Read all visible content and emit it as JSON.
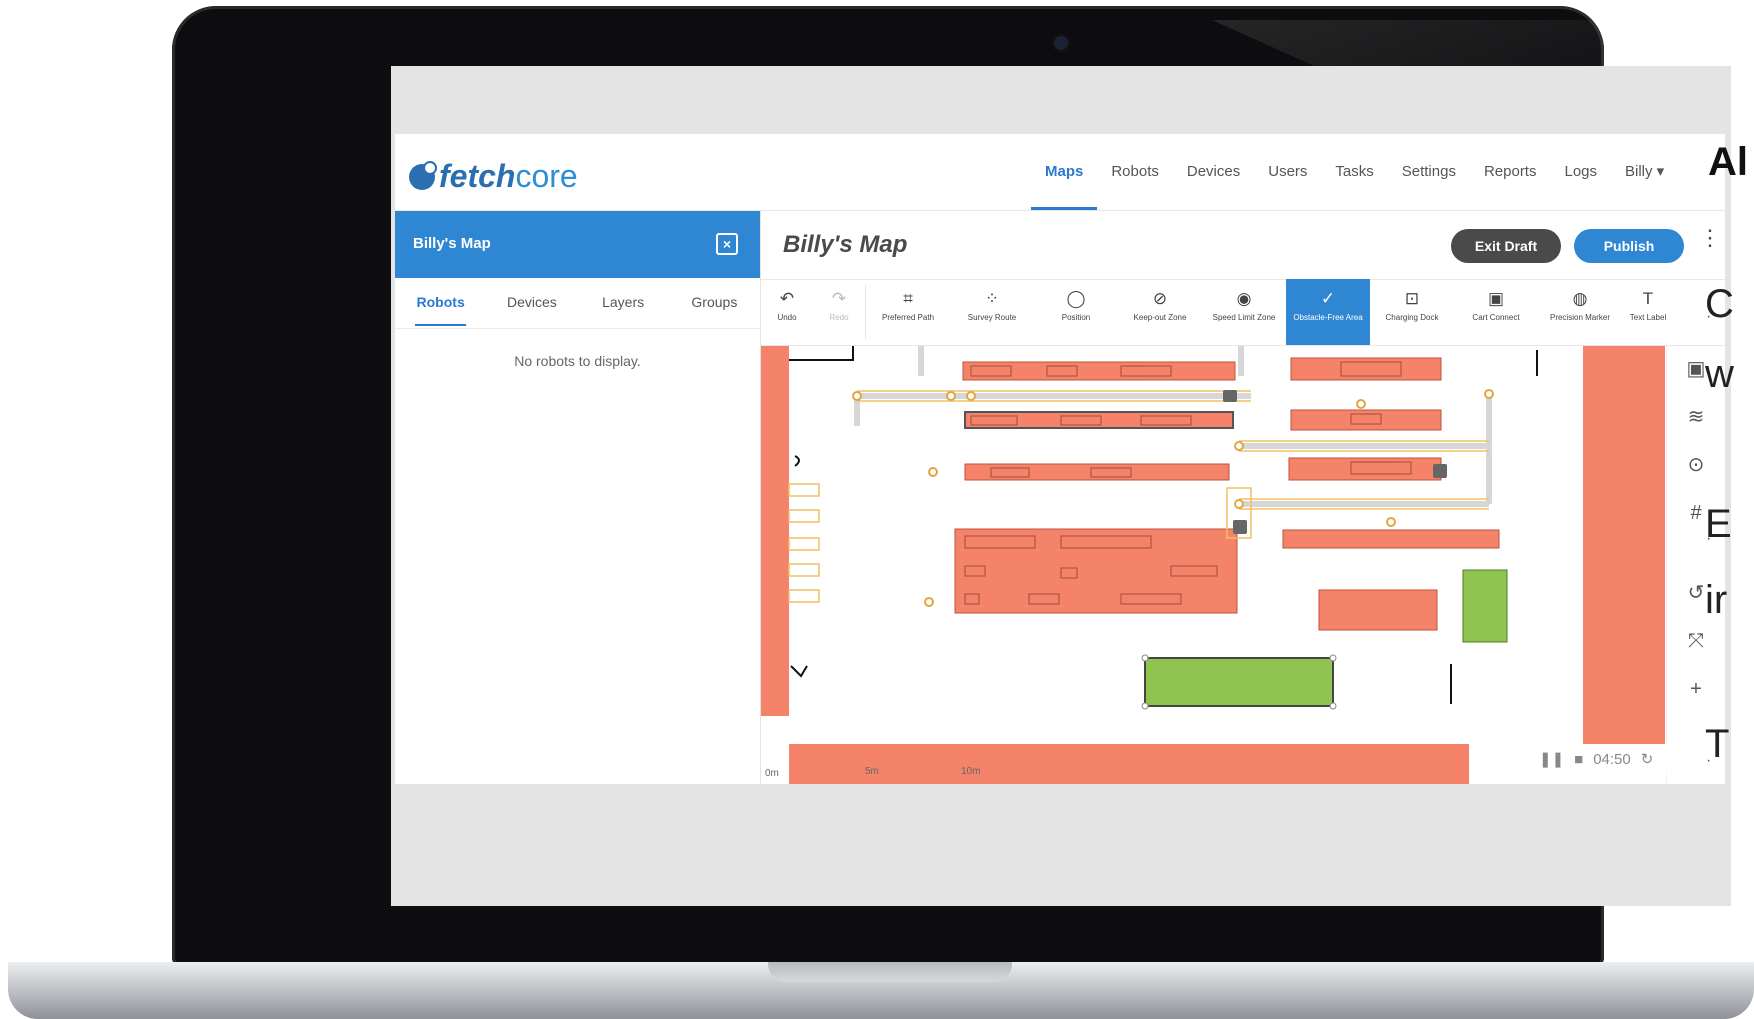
{
  "side_panel": {
    "title": "Al",
    "bullets": [
      "C",
      "w",
      "E",
      "ir",
      "T"
    ]
  },
  "app": {
    "logo": {
      "part1": "fetch",
      "part2": "core"
    },
    "nav": [
      {
        "label": "Maps",
        "active": true
      },
      {
        "label": "Robots"
      },
      {
        "label": "Devices"
      },
      {
        "label": "Users"
      },
      {
        "label": "Tasks"
      },
      {
        "label": "Settings"
      },
      {
        "label": "Reports"
      },
      {
        "label": "Logs"
      },
      {
        "label": "Billy ▾"
      }
    ],
    "sidebar": {
      "title": "Billy's Map",
      "tabs": [
        "Robots",
        "Devices",
        "Layers",
        "Groups"
      ],
      "empty_message": "No robots to display."
    },
    "main": {
      "title": "Billy's Map",
      "exit_label": "Exit Draft",
      "publish_label": "Publish"
    },
    "toolbar": [
      {
        "label": "Undo",
        "icon": "undo-icon"
      },
      {
        "label": "Redo",
        "icon": "redo-icon"
      },
      {
        "label": "Preferred Path",
        "icon": "path-icon"
      },
      {
        "label": "Survey Route",
        "icon": "survey-icon"
      },
      {
        "label": "Position",
        "icon": "position-icon"
      },
      {
        "label": "Keep-out Zone",
        "icon": "keepout-icon"
      },
      {
        "label": "Speed Limit Zone",
        "icon": "speed-icon"
      },
      {
        "label": "Obstacle-Free Area",
        "icon": "check-circle-icon"
      },
      {
        "label": "Charging Dock",
        "icon": "dock-icon"
      },
      {
        "label": "Cart Connect",
        "icon": "cart-icon"
      },
      {
        "label": "Precision Marker",
        "icon": "marker-icon"
      },
      {
        "label": "Text Label",
        "icon": "text-icon"
      }
    ],
    "map": {
      "scale_labels": [
        "0m",
        "5m",
        "10m"
      ],
      "timer": "04:50"
    },
    "colors": {
      "primary": "#2f86d2",
      "keepout_zone": "#f4836a",
      "obstacle_free": "#8ec44f",
      "path": "#f0c060"
    }
  }
}
